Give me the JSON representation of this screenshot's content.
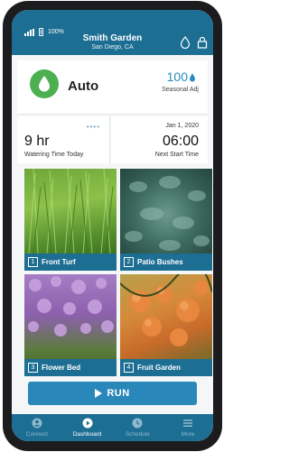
{
  "status": {
    "battery": "100%",
    "battery_icon": "battery-icon",
    "signal_icon": "signal-icon"
  },
  "header": {
    "title": "Smith Garden",
    "subtitle": "San Diego, CA",
    "icons": [
      "water-drop-icon",
      "lock-icon"
    ]
  },
  "auto": {
    "mode_label": "Auto",
    "mode_icon": "water-drop-icon",
    "seasonal_value": "100",
    "seasonal_label": "Seasonal Adj"
  },
  "watering": {
    "value": "9 hr",
    "label": "Watering Time Today",
    "more_icon": "more-dots-icon"
  },
  "next_start": {
    "date": "Jan 1, 2020",
    "time": "06:00",
    "label": "Next Start Time"
  },
  "zones": [
    {
      "number": "1",
      "name": "Front Turf"
    },
    {
      "number": "2",
      "name": "Patio Bushes"
    },
    {
      "number": "3",
      "name": "Flower Bed"
    },
    {
      "number": "4",
      "name": "Fruit Garden"
    }
  ],
  "run_button": {
    "label": "RUN",
    "icon": "play-icon"
  },
  "nav": {
    "items": [
      {
        "label": "Connect",
        "icon": "connect-icon"
      },
      {
        "label": "Dashboard",
        "icon": "dashboard-icon",
        "active": true
      },
      {
        "label": "Schedule",
        "icon": "clock-icon"
      },
      {
        "label": "More",
        "icon": "menu-icon"
      }
    ]
  },
  "colors": {
    "primary": "#1d6e93",
    "accent": "#2a87b9",
    "auto_green": "#4caf50"
  }
}
